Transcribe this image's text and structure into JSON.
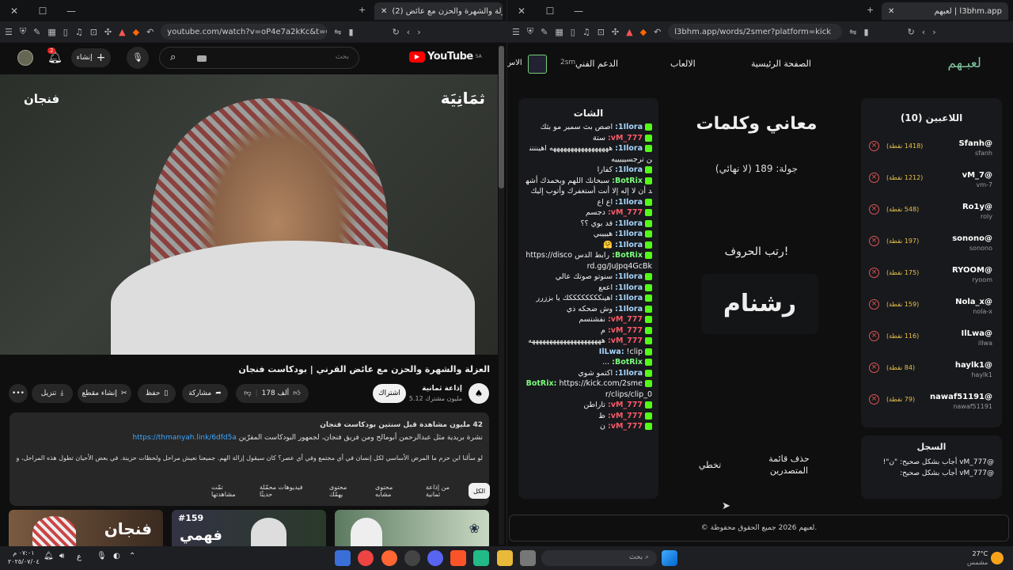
{
  "left_window": {
    "tab_title": "(2) العزلة والشهرة والحزن مع عائض...",
    "url": "youtube.com/watch?v=oP4e7a2kKc&t=6...",
    "youtube": {
      "logo": "YouTube",
      "logo_sup": "SA",
      "search_placeholder": "بحث",
      "notif_count": "2",
      "create_label": "إنشاء",
      "video_watermark_right": "ثمَانِيَة",
      "video_watermark_left": "فنجان",
      "video_title": "العزلة والشهرة والحزن مع عائض القرني | بودكاست فنجان",
      "channel_name": "إذاعة ثمانية",
      "subscribers": "5.12 مليون مشترك",
      "subscribe_label": "اشتراك",
      "likes": "178 ألف",
      "share_label": "مشاركة",
      "save_label": "حفظ",
      "clip_label": "إنشاء مقطع",
      "download_label": "تنزيل",
      "desc_line1": "42 مليون مشاهدة  قبل سنتين  بودكاست فنجان",
      "desc_line2": "نشرة بريدية مثل عبدالرحمن أبومالح ومن فريق فنجان، لجمهور البودكاست المفرّين",
      "desc_link": "https://thmanyah.link/6dfd5a",
      "desc_line3": "لو سألنا ابن حزم ما المرض الأساسي لكل إنسان في أي مجتمع وفي أي عصر؟ كان سيقول إزالة الهم. جميعنا نعيش مراحل ولحظات حزينة. في بعض الأحيان تطول هذه المراحل، وبحسب الناس يكون ... المزيد",
      "chips": [
        "الكل",
        "من إذاعة ثمانية",
        "محتوى مشابه",
        "محتوى يهمّك",
        "فيديوهات محمّلة حديثًا",
        "تمّت مشاهدتها"
      ],
      "thumb_badge": "#159",
      "thumb_text_1": "فنجان",
      "thumb_text_2": "فهمي"
    }
  },
  "right_window": {
    "tab_title": "لعبهم | l3bhm.app",
    "url": "l3bhm.app/words/2smer?platform=kick",
    "site": {
      "logo": "لعبـهم",
      "nav": [
        "الصفحة الرئيسية",
        "الالعاب",
        "الدعم الفني",
        "الاس"
      ],
      "nav_user": "2sm",
      "players_title": "اللاعبين (10)",
      "players": [
        {
          "name": "@Sfanh",
          "user": "sfanh",
          "points": "(1418 نقطة)"
        },
        {
          "name": "@vM_7",
          "user": "vm-7",
          "points": "(1212 نقطة)"
        },
        {
          "name": "@Ro1y",
          "user": "roly",
          "points": "(548 نقطة)"
        },
        {
          "name": "@sonono",
          "user": "sonono",
          "points": "(197 نقطة)"
        },
        {
          "name": "@RYOOM",
          "user": "ryoom",
          "points": "(175 نقطة)"
        },
        {
          "name": "@Nola_x",
          "user": "nola-x",
          "points": "(159 نقطة)"
        },
        {
          "name": "@IlLwa",
          "user": "illwa",
          "points": "(116 نقطة)"
        },
        {
          "name": "@haylk1",
          "user": "haylk1",
          "points": "(84 نقطة)"
        },
        {
          "name": "@nawaf51191",
          "user": "nawaf51191",
          "points": "(79 نقطة)"
        }
      ],
      "log_title": "السجل",
      "log": [
        "@vM_777 أجاب بشكل صحيح: \"ن\"!",
        "@vM_777 أجاب بشكل صحيح:"
      ],
      "game_title": "معاني وكلمات",
      "round": "جولة: 189 (لا نهائي)",
      "prompt": "رتب الحروف!",
      "scramble": "رشنام",
      "skip_label": "تخطي",
      "clear_board_label": "حذف قائمة المتصدرين",
      "chat_title": "الشات",
      "chat": [
        {
          "u": "1Ilora:",
          "t": "اصص بث سمير مو بثك"
        },
        {
          "u": "vM_777:",
          "t": "ستة"
        },
        {
          "u": "1Ilora:",
          "t": "هههههههههههههههههه اهيننننن ترجسيييييه"
        },
        {
          "u": "1Ilora:",
          "t": "كفارا"
        },
        {
          "u": "BotRix:",
          "t": "سبحانك اللهم وبحمدك أشهد أن لا إله إلا أنت أستغفرك وأتوب إليك"
        },
        {
          "u": "1Ilora:",
          "t": "اع اع"
        },
        {
          "u": "vM_777:",
          "t": "دجسم"
        },
        {
          "u": "1Ilora:",
          "t": "قد بوي ؟؟"
        },
        {
          "u": "1Ilora:",
          "t": "هيييبي"
        },
        {
          "u": "1Ilora:",
          "t": "🤗"
        },
        {
          "u": "BotRix:",
          "t": "رابط الدس https://discord.gg/JuJpq4GcBk"
        },
        {
          "u": "1Ilora:",
          "t": "سنوتو صوتك عالي"
        },
        {
          "u": "1Ilora:",
          "t": "اععع"
        },
        {
          "u": "1Ilora:",
          "t": "اهينككككككككك يا بززرر"
        },
        {
          "u": "1Ilora:",
          "t": "وش ضحكه ذي"
        },
        {
          "u": "vM_777:",
          "t": "نفشتسم"
        },
        {
          "u": "vM_777:",
          "t": "م"
        },
        {
          "u": "vM_777:",
          "t": "هههههههههههههههههههههه"
        },
        {
          "u": "IlLwa:",
          "t": "!clip"
        },
        {
          "u": "BotRix:",
          "t": "..."
        },
        {
          "u": "1Ilora:",
          "t": "اكتمو شوي"
        },
        {
          "u": "BotRix:",
          "t": "https://kick.com/2smer/clips/clip_0"
        },
        {
          "u": "vM_777:",
          "t": "تاراطن"
        },
        {
          "u": "vM_777:",
          "t": "ظ"
        },
        {
          "u": "vM_777:",
          "t": "ن"
        }
      ],
      "footer": "© لعبهم 2026 جميع الحقوق محفوظة."
    }
  },
  "taskbar": {
    "time": "٠٧:٠١ م",
    "date": "٢٠٢٥/٠٧/٠٤",
    "search_placeholder": "بحث",
    "lang": "ع",
    "weather_temp": "27°C",
    "weather_text": "مشمس"
  }
}
